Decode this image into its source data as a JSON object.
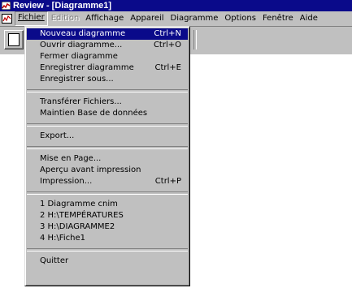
{
  "window": {
    "title": "Review - [Diagramme1]"
  },
  "menubar": {
    "items": [
      {
        "label": "Fichier",
        "state": "open"
      },
      {
        "label": "Edition",
        "state": "disabled"
      },
      {
        "label": "Affichage"
      },
      {
        "label": "Appareil"
      },
      {
        "label": "Diagramme"
      },
      {
        "label": "Options"
      },
      {
        "label": "Fenêtre"
      },
      {
        "label": "Aide"
      }
    ]
  },
  "file_menu": {
    "group1": [
      {
        "label": "Nouveau diagramme",
        "shortcut": "Ctrl+N"
      },
      {
        "label": "Ouvrir diagramme...",
        "shortcut": "Ctrl+O"
      },
      {
        "label": "Fermer diagramme",
        "shortcut": ""
      },
      {
        "label": "Enregistrer diagramme",
        "shortcut": "Ctrl+E"
      },
      {
        "label": "Enregistrer sous...",
        "shortcut": ""
      }
    ],
    "group2": [
      {
        "label": "Transférer Fichiers..."
      },
      {
        "label": "Maintien Base de données"
      }
    ],
    "group3": [
      {
        "label": "Export..."
      }
    ],
    "group4": [
      {
        "label": "Mise en Page..."
      },
      {
        "label": "Aperçu avant impression"
      },
      {
        "label": "Impression...",
        "shortcut": "Ctrl+P"
      }
    ],
    "recent": [
      {
        "label": "1 Diagramme cnim"
      },
      {
        "label": "2 H:\\TEMPÉRATURES"
      },
      {
        "label": "3 H:\\DIAGRAMME2"
      },
      {
        "label": "4 H:\\Fiche1"
      }
    ],
    "quit": {
      "label": "Quitter"
    }
  },
  "colors": {
    "title_bar": "#0a0a8a",
    "highlight": "#0a0a8a",
    "chrome": "#c0c0c0"
  },
  "icons": {
    "app": "review-app-icon",
    "doc": "document-icon",
    "toolbar_new": "new-document-icon"
  }
}
